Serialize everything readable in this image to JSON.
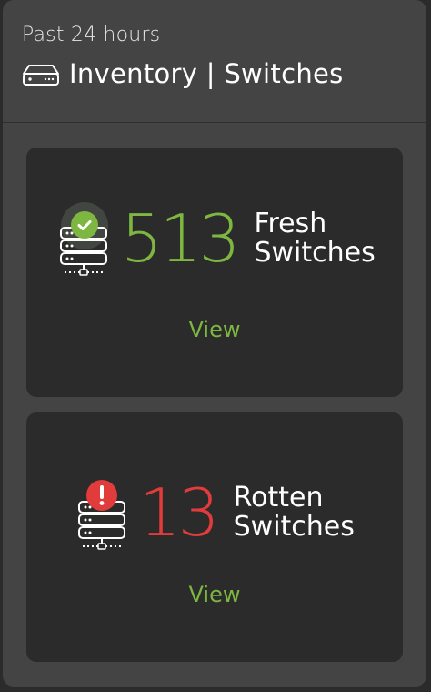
{
  "header": {
    "subtitle": "Past 24 hours",
    "title": "Inventory | Switches",
    "icon": "switch-device-icon"
  },
  "cards": {
    "fresh": {
      "count": "513",
      "label_line1": "Fresh",
      "label_line2": "Switches",
      "link": "View",
      "icon": "server-stack-icon",
      "badge_icon": "check-badge-icon",
      "accent_color": "#7db741"
    },
    "rotten": {
      "count": "13",
      "label_line1": "Rotten",
      "label_line2": "Switches",
      "link": "View",
      "icon": "server-stack-icon",
      "badge_icon": "alert-badge-icon",
      "accent_color": "#e23b3b"
    }
  },
  "colors": {
    "panel": "#444444",
    "card": "#2b2b2b",
    "link": "#7db741"
  }
}
